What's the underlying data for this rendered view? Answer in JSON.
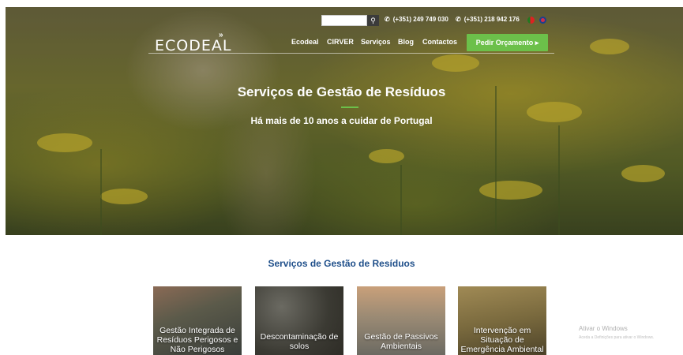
{
  "search": {
    "placeholder": "",
    "button_icon": "search-icon"
  },
  "header": {
    "phone1": "(+351) 249 749 030",
    "phone2": "(+351) 218 942 176",
    "phone_icon": "phone-icon",
    "languages": [
      "pt-flag-icon",
      "uk-flag-icon"
    ]
  },
  "logo": {
    "text": "ECODEAL",
    "mark": "»"
  },
  "nav": {
    "items": [
      "Ecodeal",
      "CIRVER",
      "Serviços",
      "Blog",
      "Contactos"
    ],
    "cta": "Pedir Orçamento ▸"
  },
  "hero": {
    "title": "Serviços de Gestão de Resíduos",
    "subtitle": "Há mais de 10 anos a cuidar de Portugal"
  },
  "section": {
    "title": "Serviços de Gestão de Resíduos",
    "cards": [
      "Gestão Integrada de Resíduos Perigosos e Não Perigosos",
      "Descontaminação de solos",
      "Gestão de Passivos Ambientais",
      "Intervenção em Situação de Emergência Ambiental"
    ]
  },
  "watermark": {
    "title": "Ativar o Windows",
    "subtitle": "Aceda a Definições para ativar o Windows."
  },
  "colors": {
    "accent": "#6cc04a",
    "section_title": "#1f4f8a"
  }
}
